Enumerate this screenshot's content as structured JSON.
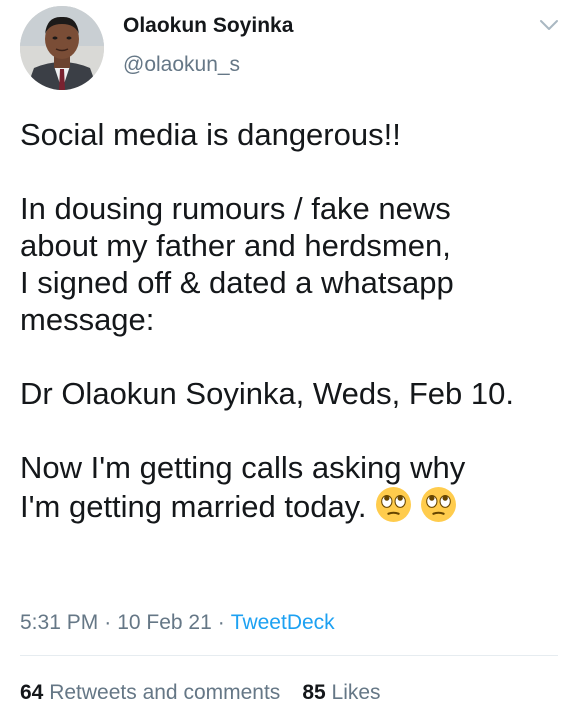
{
  "author": {
    "display_name": "Olaokun Soyinka",
    "handle": "@olaokun_s"
  },
  "tweet": {
    "lines": [
      "Social media is dangerous!!",
      "",
      "In dousing rumours / fake news",
      "about my father and herdsmen,",
      "I signed off & dated a whatsapp",
      "message:",
      "",
      "Dr Olaokun Soyinka, Weds, Feb 10.",
      "",
      "Now I'm getting calls asking why",
      "I'm getting married today."
    ],
    "trailing_emoji": [
      "face-with-rolling-eyes-emoji",
      "face-with-rolling-eyes-emoji"
    ]
  },
  "meta": {
    "time": "5:31 PM",
    "separator": "·",
    "date": "10 Feb 21",
    "source": "TweetDeck"
  },
  "stats": {
    "retweets_count": "64",
    "retweets_label": "Retweets and comments",
    "likes_count": "85",
    "likes_label": "Likes"
  },
  "icons": {
    "menu": "chevron-down-icon"
  },
  "colors": {
    "text": "#14171a",
    "secondary": "#657786",
    "link": "#1da1f2",
    "divider": "#e6ecf0"
  }
}
